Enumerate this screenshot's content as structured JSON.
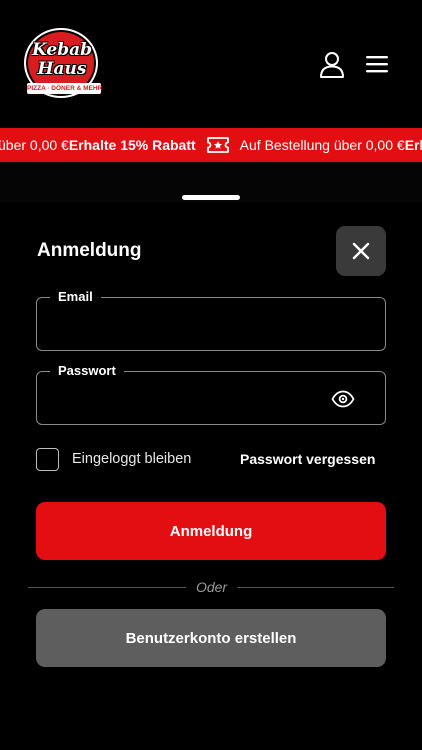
{
  "brand": {
    "logo_line1": "Kebab",
    "logo_line2": "Haus",
    "logo_tagline": "PIZZA · DÖNER & MEHR",
    "primary_color": "#e30e12"
  },
  "header": {
    "user_icon": "user-icon",
    "menu_icon": "hamburger-menu-icon"
  },
  "ticker": {
    "items": [
      {
        "text": "über 0,00 €",
        "bold": false
      },
      {
        "text": "Erhalte 15% Rabatt",
        "bold": true
      },
      {
        "text": "ticket-icon",
        "icon": true
      },
      {
        "text": "Auf Bestellung über 0,00 €",
        "bold": false
      },
      {
        "text": "Erhalte",
        "bold": true
      }
    ]
  },
  "modal": {
    "title": "Anmeldung",
    "close_icon": "close-icon",
    "email": {
      "label": "Email",
      "value": "",
      "placeholder": ""
    },
    "password": {
      "label": "Passwort",
      "value": "",
      "placeholder": "",
      "toggle_icon": "eye-icon"
    },
    "remember_me": {
      "label": "Eingeloggt bleiben",
      "checked": false
    },
    "forgot_password": "Passwort vergessen",
    "login_button": "Anmeldung",
    "separator": "Oder",
    "register_button": "Benutzerkonto erstellen"
  }
}
